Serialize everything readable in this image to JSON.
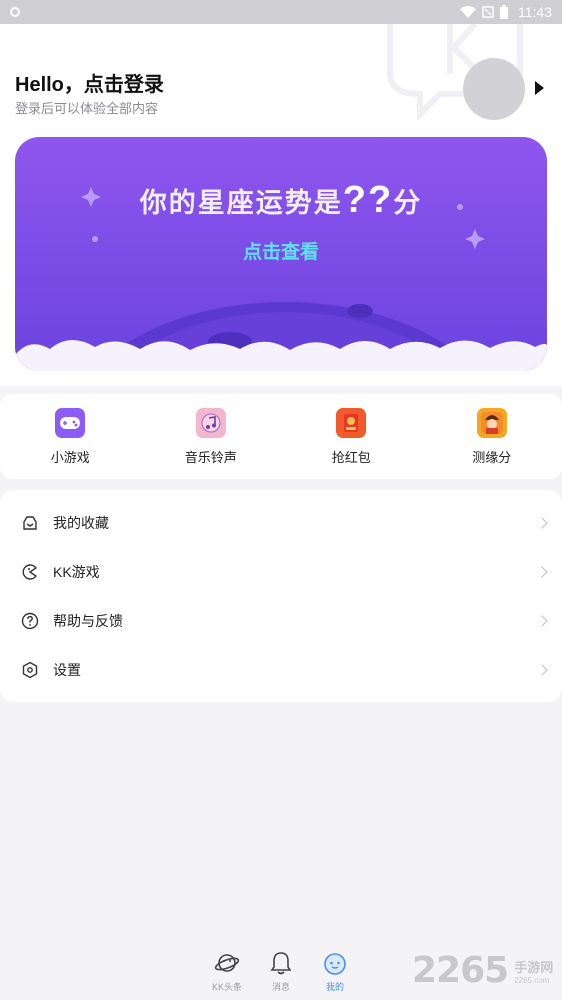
{
  "status_bar": {
    "time": "11:43",
    "icons": [
      "notification-dot-icon",
      "wifi-icon",
      "sim-icon",
      "battery-icon"
    ]
  },
  "header": {
    "greeting": "Hello，点击登录",
    "subtitle": "登录后可以体验全部内容"
  },
  "banner": {
    "title": "你的星座运势是",
    "title_qq": "??",
    "title_suffix": "分",
    "cta": "点击查看"
  },
  "quick_actions": [
    {
      "label": "小游戏",
      "icon": "gamepad-icon",
      "color": "#8b5cf6"
    },
    {
      "label": "音乐铃声",
      "icon": "music-note-icon",
      "color": "#f2b7cc"
    },
    {
      "label": "抢红包",
      "icon": "red-packet-icon",
      "color": "#f25a2a"
    },
    {
      "label": "测缘分",
      "icon": "fortune-icon",
      "color": "#f5a623"
    }
  ],
  "menu": [
    {
      "label": "我的收藏",
      "icon": "favorites-icon"
    },
    {
      "label": "KK游戏",
      "icon": "pacman-icon"
    },
    {
      "label": "帮助与反馈",
      "icon": "help-icon"
    },
    {
      "label": "设置",
      "icon": "settings-icon"
    }
  ],
  "bottom_nav": [
    {
      "label": "KK头条",
      "icon": "planet-icon",
      "active": false
    },
    {
      "label": "消息",
      "icon": "bell-icon",
      "active": false
    },
    {
      "label": "我的",
      "icon": "face-icon",
      "active": true
    }
  ],
  "site_watermark": {
    "number": "2265",
    "cn": "手游网",
    "domain": "2265.com"
  },
  "colors": {
    "accent": "#4a8ef5",
    "banner_top": "#8f56ee",
    "banner_bottom": "#6a43df",
    "cta": "#5ee2f0"
  }
}
